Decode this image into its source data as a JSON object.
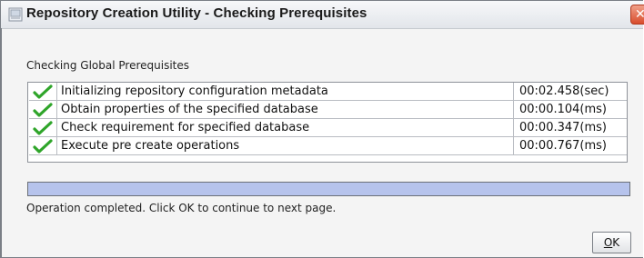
{
  "window": {
    "title": "Repository Creation Utility - Checking Prerequisites",
    "close_glyph": "✕",
    "app_icon": "rcu-app-icon"
  },
  "section": {
    "label": "Checking Global Prerequisites"
  },
  "checks": [
    {
      "name": "Initializing repository configuration metadata",
      "time": "00:02.458(sec)",
      "status_icon": "check-icon"
    },
    {
      "name": "Obtain properties of the specified database",
      "time": "00:00.104(ms)",
      "status_icon": "check-icon"
    },
    {
      "name": "Check requirement for specified database",
      "time": "00:00.347(ms)",
      "status_icon": "check-icon"
    },
    {
      "name": "Execute pre create operations",
      "time": "00:00.767(ms)",
      "status_icon": "check-icon"
    }
  ],
  "progress": {
    "percent": 100
  },
  "status": {
    "message": "Operation completed. Click OK to continue to next page."
  },
  "buttons": {
    "ok_mnemonic": "O",
    "ok_rest": "K"
  },
  "colors": {
    "check": "#2fa52a",
    "progress_fill": "#b6c3ec",
    "close_button": "#d94d2d"
  }
}
